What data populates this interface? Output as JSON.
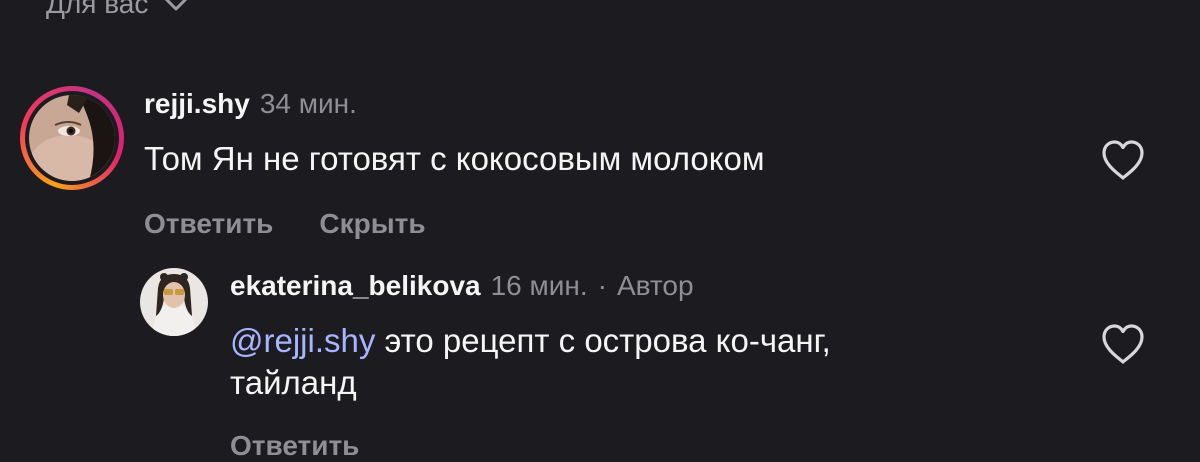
{
  "filter": {
    "label": "Для вас",
    "icon": "chevron-down-icon"
  },
  "comments": [
    {
      "username": "rejji.shy",
      "time": "34 мин.",
      "text": "Том Ян не готовят с кокосовым молоком",
      "actions": {
        "reply": "Ответить",
        "hide": "Скрыть"
      },
      "like_icon": "heart-outline-icon",
      "story_ring_colors": [
        "#f7a21b",
        "#f5375b",
        "#c13584"
      ]
    }
  ],
  "reply": {
    "username": "ekaterina_belikova",
    "time": "16 мин.",
    "separator": "·",
    "author_badge": "Автор",
    "mention": "@rejji.shy",
    "text_line1": " это рецепт с острова ко-чанг,",
    "text_line2": "тайланд",
    "actions": {
      "reply": "Ответить"
    },
    "like_icon": "heart-outline-icon"
  },
  "colors": {
    "background": "#1c1c20",
    "primary_text": "#f5f5f5",
    "secondary_text": "#8e8e94",
    "mention": "#a9b4ff"
  }
}
